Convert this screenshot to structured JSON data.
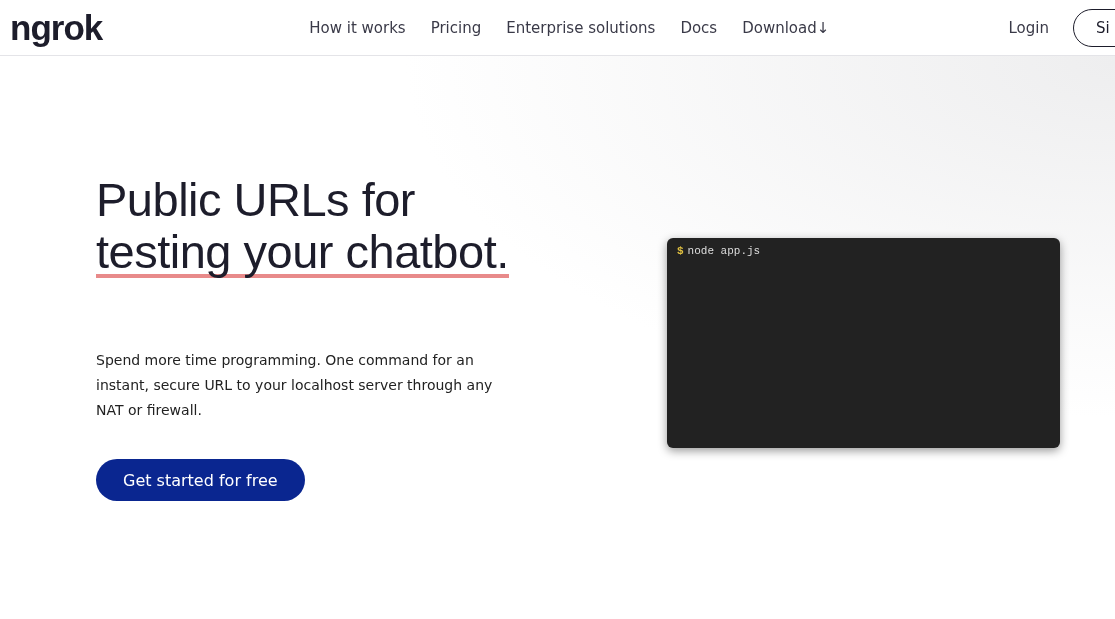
{
  "header": {
    "logo": "ngrok",
    "nav": [
      {
        "label": "How it works"
      },
      {
        "label": "Pricing"
      },
      {
        "label": "Enterprise solutions"
      },
      {
        "label": "Docs"
      },
      {
        "label": "Download↓"
      }
    ],
    "login": "Login",
    "signup": "Si"
  },
  "hero": {
    "title_line_1": "Public URLs for",
    "title_line_2": "testing your chatbot.",
    "description": "Spend more time programming. One command for an instant, secure URL to your localhost server through any NAT or firewall.",
    "cta": "Get started for free"
  },
  "terminal": {
    "prompt": "$",
    "command": "node app.js"
  }
}
